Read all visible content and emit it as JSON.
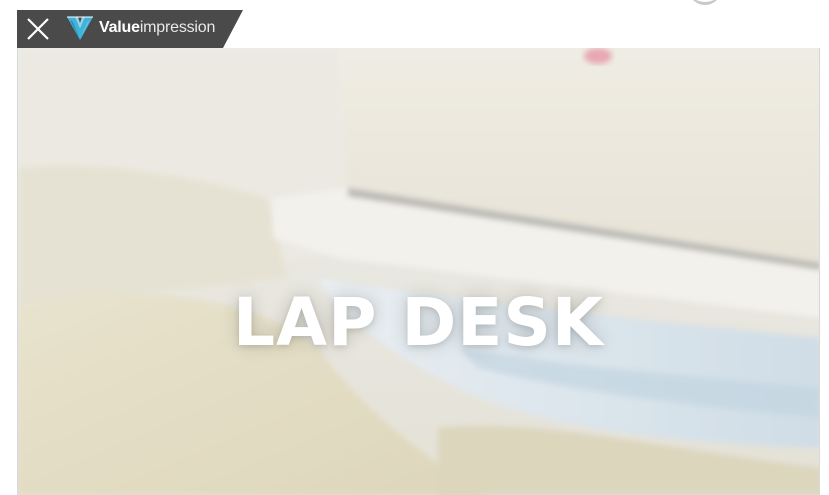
{
  "ad": {
    "brand_bold": "Value",
    "brand_light": "impression",
    "close_icon": "close-icon",
    "logo_icon": "valueimpression-logo-icon",
    "tab_color": "#4a4a4a"
  },
  "video": {
    "caption": "LAP DESK"
  }
}
